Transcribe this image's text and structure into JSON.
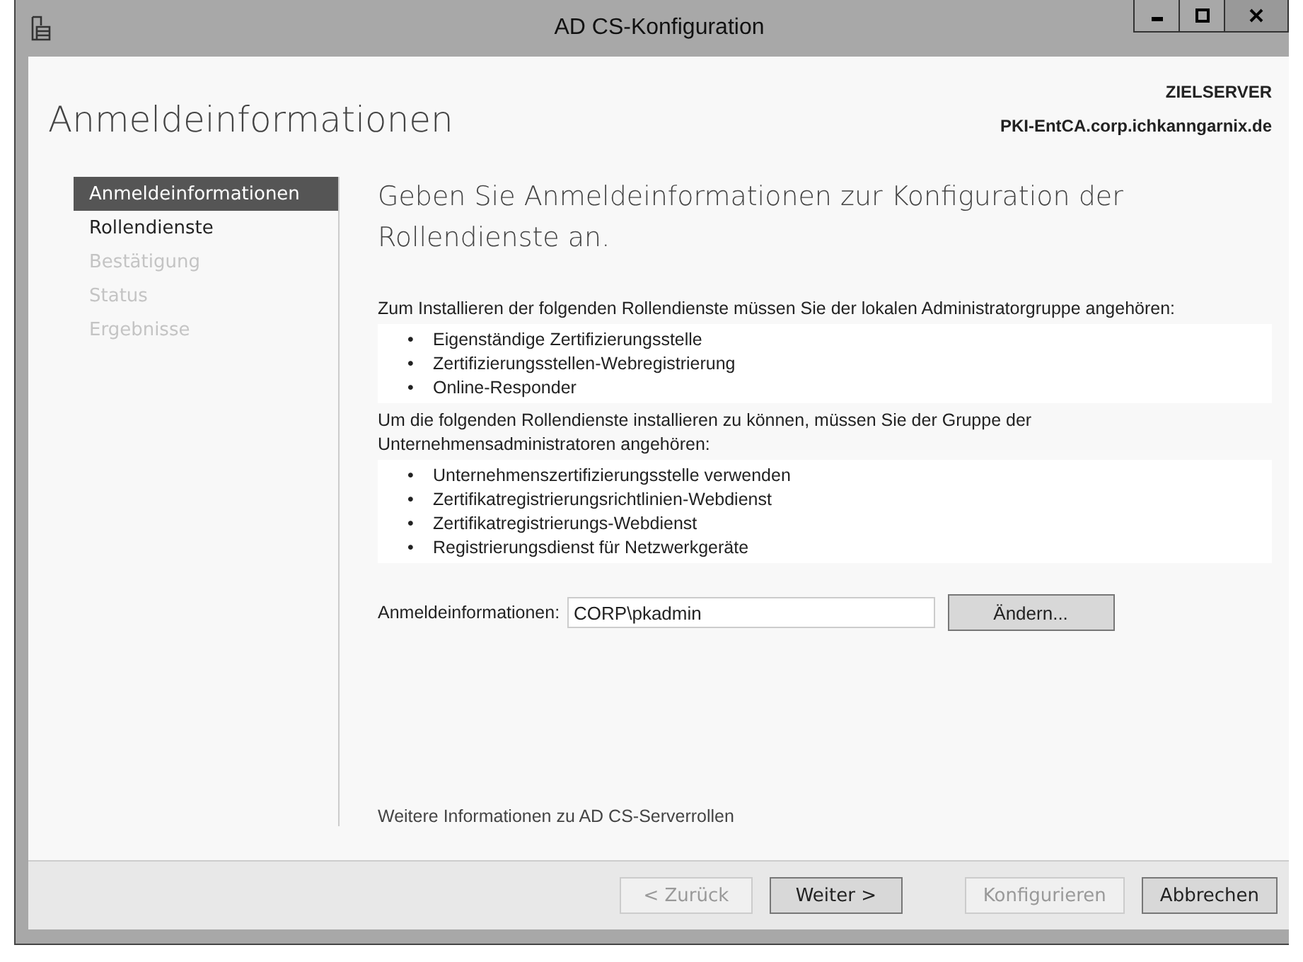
{
  "window": {
    "title": "AD CS-Konfiguration"
  },
  "page_title": "Anmeldeinformationen",
  "target_server": {
    "label": "ZIELSERVER",
    "name": "PKI-EntCA.corp.ichkanngarnix.de"
  },
  "sidebar": {
    "items": [
      {
        "label": "Anmeldeinformationen",
        "selected": true,
        "disabled": false
      },
      {
        "label": "Rollendienste",
        "selected": false,
        "disabled": false
      },
      {
        "label": "Bestätigung",
        "selected": false,
        "disabled": true
      },
      {
        "label": "Status",
        "selected": false,
        "disabled": true
      },
      {
        "label": "Ergebnisse",
        "selected": false,
        "disabled": true
      }
    ]
  },
  "heading": "Geben Sie Anmeldeinformationen zur Konfiguration der Rollendienste an.",
  "bullet": "•",
  "sections": [
    {
      "text": "Zum Installieren der folgenden Rollendienste müssen Sie der lokalen Administratorgruppe angehören:",
      "items": [
        "Eigenständige Zertifizierungsstelle",
        "Zertifizierungsstellen-Webregistrierung",
        "Online-Responder"
      ]
    },
    {
      "text": "Um die folgenden Rollendienste installieren zu können, müssen Sie der Gruppe der Unternehmensadministratoren angehören:",
      "items": [
        "Unternehmenszertifizierungsstelle verwenden",
        "Zertifikatregistrierungsrichtlinien-Webdienst",
        "Zertifikatregistrierungs-Webdienst",
        "Registrierungsdienst für Netzwerkgeräte"
      ]
    }
  ],
  "credentials": {
    "label": "Anmeldeinformationen:",
    "value": "CORP\\pkadmin",
    "button": "Ändern..."
  },
  "more_info_link": "Weitere Informationen zu AD CS-Serverrollen",
  "buttons": [
    {
      "label": "< Zurück",
      "disabled": true
    },
    {
      "label": "Weiter >",
      "disabled": false
    },
    {
      "label": "Konfigurieren",
      "disabled": true
    },
    {
      "label": "Abbrechen",
      "disabled": false
    }
  ]
}
